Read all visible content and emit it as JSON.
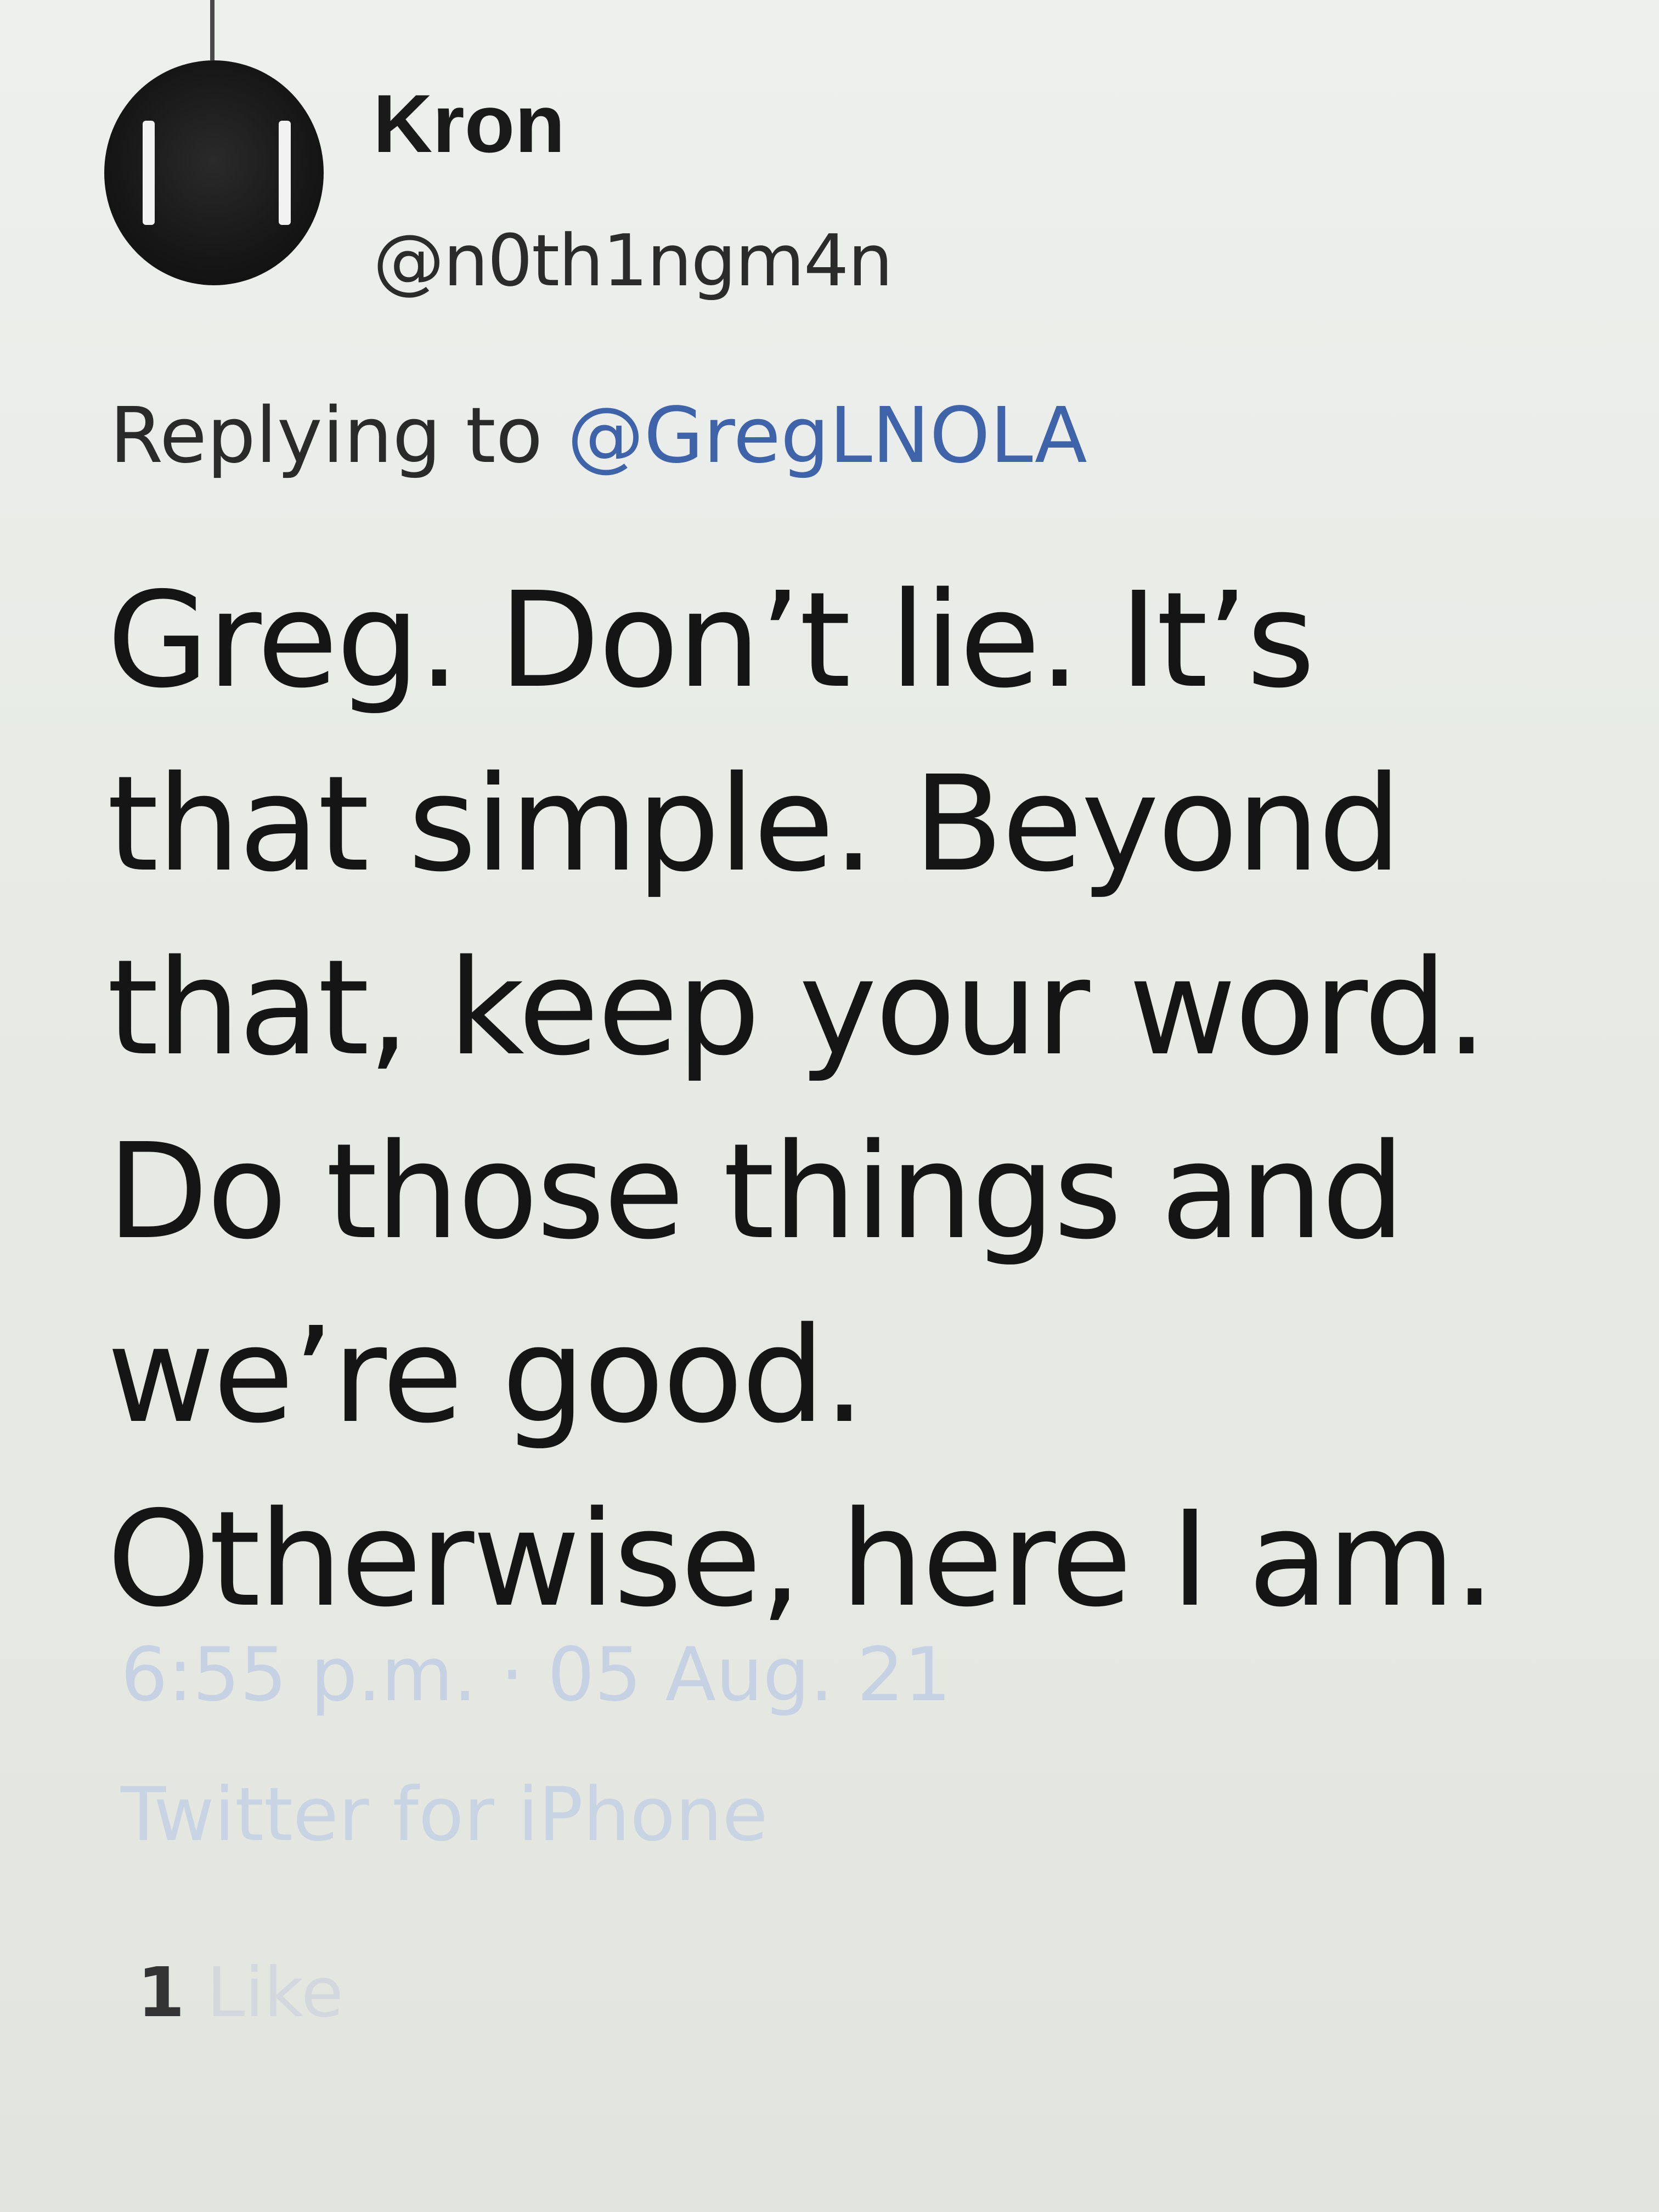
{
  "tweet": {
    "display_name": "Kron",
    "handle": "@n0th1ngm4n",
    "reply_prefix": "Replying to",
    "reply_to": "@GregLNOLA",
    "text": "Greg. Don’t lie. It’s that simple. Beyond that, keep your word. Do those things and we’re good. Otherwise, here I am.",
    "time": "6:55 p.m.",
    "separator": "·",
    "date": "05 Aug. 21",
    "source": "Twitter for iPhone",
    "likes_count": "1",
    "likes_label": "Like"
  },
  "colors": {
    "mention": "#3f63a8",
    "meta": "#c6d2e4",
    "background": "#e8ebe6"
  }
}
